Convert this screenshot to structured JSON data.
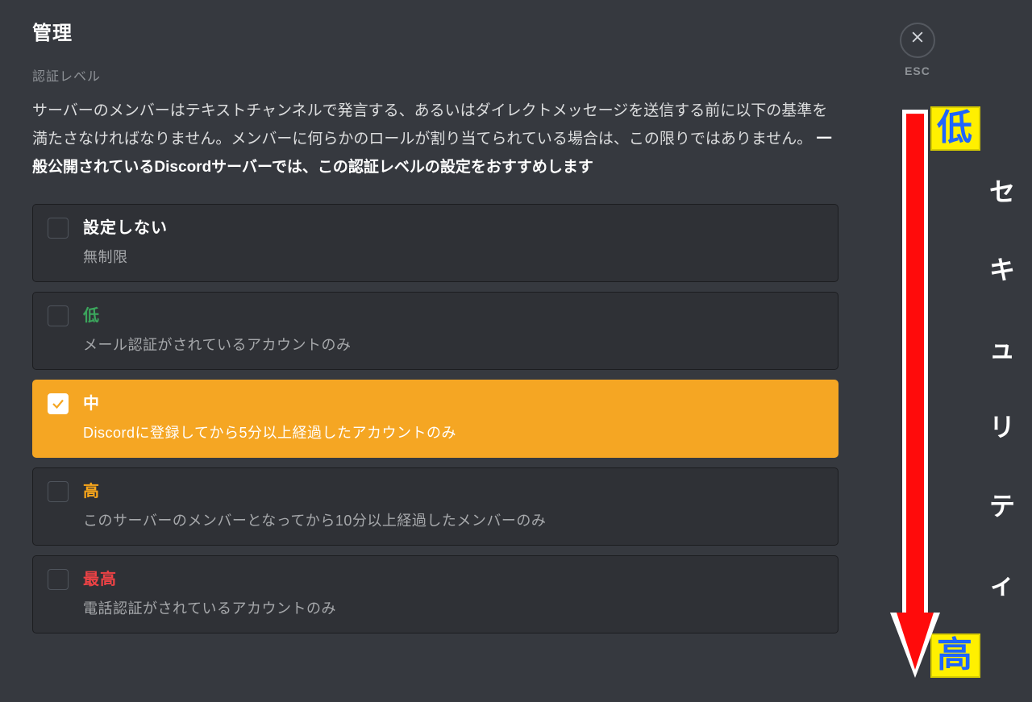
{
  "page": {
    "title": "管理",
    "section_label": "認証レベル",
    "description_plain": "サーバーのメンバーはテキストチャンネルで発言する、あるいはダイレクトメッセージを送信する前に以下の基準を満たさなければなりません。メンバーに何らかのロールが割り当てられている場合は、この限りではありません。 ",
    "description_bold": "一般公開されているDiscordサーバーでは、この認証レベルの設定をおすすめします"
  },
  "close": {
    "esc_label": "ESC"
  },
  "options": [
    {
      "key": "none",
      "title": "設定しない",
      "desc": "無制限",
      "selected": false,
      "level_class": "lvl-none"
    },
    {
      "key": "low",
      "title": "低",
      "desc": "メール認証がされているアカウントのみ",
      "selected": false,
      "level_class": "lvl-low"
    },
    {
      "key": "medium",
      "title": "中",
      "desc": "Discordに登録してから5分以上経過したアカウントのみ",
      "selected": true,
      "level_class": "lvl-med"
    },
    {
      "key": "high",
      "title": "高",
      "desc": "このサーバーのメンバーとなってから10分以上経過したメンバーのみ",
      "selected": false,
      "level_class": "lvl-high"
    },
    {
      "key": "highest",
      "title": "最高",
      "desc": "電話認証がされているアカウントのみ",
      "selected": false,
      "level_class": "lvl-max"
    }
  ],
  "annotation": {
    "top_tag": "低",
    "bottom_tag": "高",
    "side_text": [
      "セ",
      "キ",
      "ュ",
      "リ",
      "テ",
      "ィ"
    ]
  }
}
